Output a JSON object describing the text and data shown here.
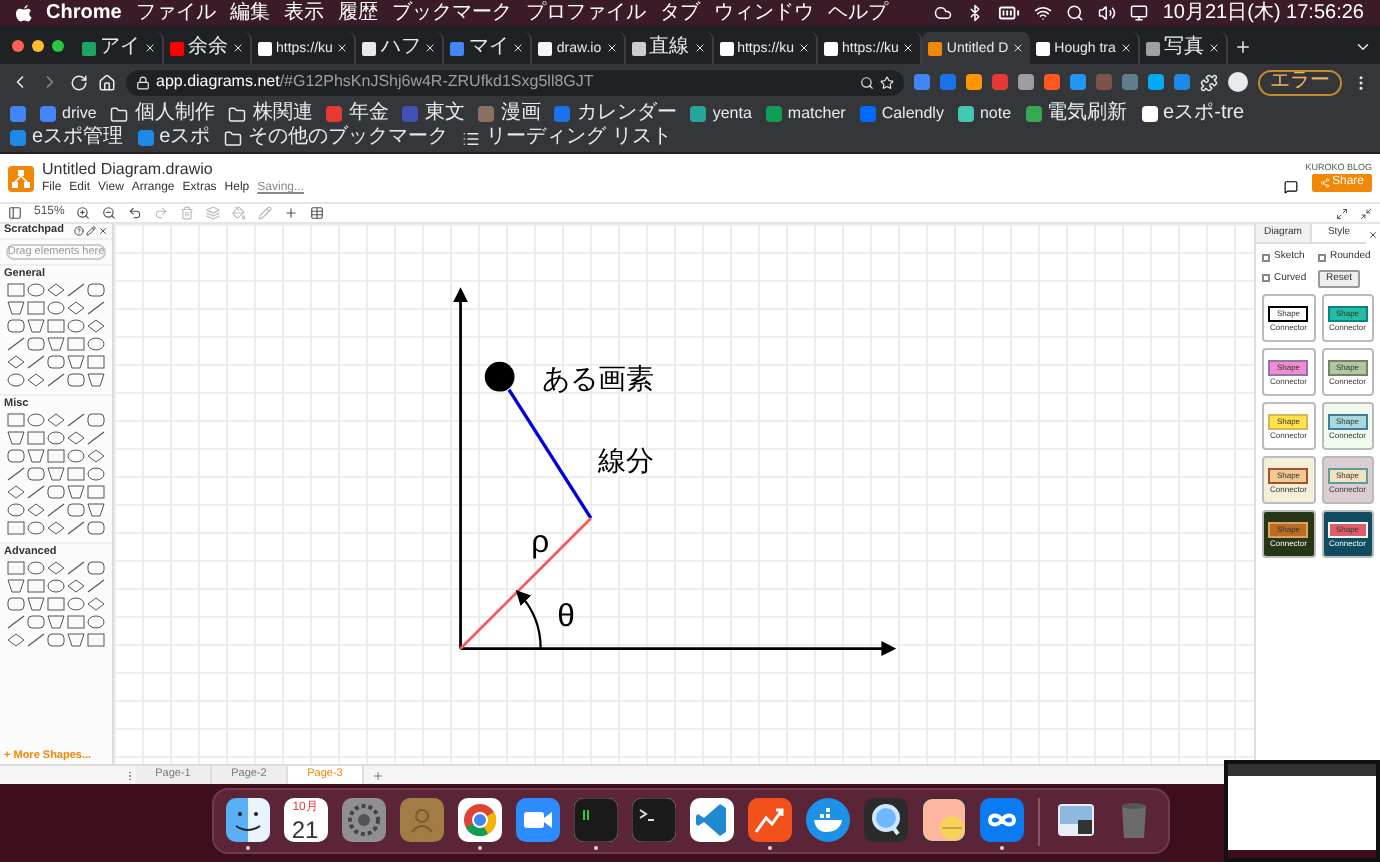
{
  "menubar": {
    "app": "Chrome",
    "items": [
      "ファイル",
      "編集",
      "表示",
      "履歴",
      "ブックマーク",
      "プロファイル",
      "タブ",
      "ウィンドウ",
      "ヘルプ"
    ],
    "clock": "10月21日(木) 17:56:26"
  },
  "tabs": [
    {
      "title": "アイ",
      "selected": false
    },
    {
      "title": "余余",
      "selected": false
    },
    {
      "title": "https://ku",
      "selected": false
    },
    {
      "title": "ハフ",
      "selected": false
    },
    {
      "title": "マイ",
      "selected": false
    },
    {
      "title": "draw.io",
      "selected": false
    },
    {
      "title": "直線",
      "selected": false
    },
    {
      "title": "https://ku",
      "selected": false
    },
    {
      "title": "https://ku",
      "selected": false
    },
    {
      "title": "Untitled D",
      "selected": true
    },
    {
      "title": "Hough tra",
      "selected": false
    },
    {
      "title": "写真",
      "selected": false
    }
  ],
  "address": {
    "host": "app.diagrams.net",
    "path": "/#G12PhsKnJShj6w4R-ZRUfkd1Sxg5ll8GJT"
  },
  "profile_button": "エラー",
  "bookmarks": [
    {
      "label": "drive",
      "kind": "site"
    },
    {
      "label": "個人制作",
      "kind": "folder"
    },
    {
      "label": "株関連",
      "kind": "folder"
    },
    {
      "label": "年金",
      "kind": "site"
    },
    {
      "label": "東文",
      "kind": "site"
    },
    {
      "label": "漫画",
      "kind": "site"
    },
    {
      "label": "カレンダー",
      "kind": "site"
    },
    {
      "label": "yenta",
      "kind": "site"
    },
    {
      "label": "matcher",
      "kind": "site"
    },
    {
      "label": "Calendly",
      "kind": "site"
    },
    {
      "label": "note",
      "kind": "site"
    },
    {
      "label": "電気刷新",
      "kind": "site"
    },
    {
      "label": "eスポ-tre",
      "kind": "site"
    },
    {
      "label": "eスポ管理",
      "kind": "site"
    },
    {
      "label": "eスポ",
      "kind": "site"
    },
    {
      "label": "その他のブックマーク",
      "kind": "folder"
    },
    {
      "label": "リーディング リスト",
      "kind": "list"
    }
  ],
  "drawio": {
    "title": "Untitled Diagram.drawio",
    "menus": [
      "File",
      "Edit",
      "View",
      "Arrange",
      "Extras",
      "Help"
    ],
    "status": "Saving...",
    "user": "KUROKO BLOG",
    "share": "Share",
    "zoom": "515%",
    "sidebar": {
      "scratchpad": "Scratchpad",
      "drop_hint": "Drag elements here",
      "sections": [
        "General",
        "Misc",
        "Advanced"
      ],
      "more": "+ More Shapes..."
    },
    "format_panel": {
      "tabs": [
        {
          "label": "Diagram",
          "selected": false
        },
        {
          "label": "Style",
          "selected": true
        }
      ],
      "options": [
        {
          "label": "Sketch",
          "checked": false
        },
        {
          "label": "Rounded",
          "checked": false
        },
        {
          "label": "Curved",
          "checked": false
        }
      ],
      "reset": "Reset",
      "styles": [
        {
          "shape": "Shape",
          "connector": "Connector",
          "color": "#ffffff"
        },
        {
          "shape": "Shape",
          "connector": "Connector",
          "color": "#21c0a5"
        },
        {
          "shape": "Shape",
          "connector": "Connector",
          "color": "#f08cd0"
        },
        {
          "shape": "Shape",
          "connector": "Connector",
          "color": "#b2c7a2"
        },
        {
          "shape": "Shape",
          "connector": "Connector",
          "color": "#ffe34a"
        },
        {
          "shape": "Shape",
          "connector": "Connector",
          "color": "#a8dadc"
        },
        {
          "shape": "Shape",
          "connector": "Connector",
          "color": "#f2c894"
        },
        {
          "shape": "Shape",
          "connector": "Connector",
          "color": "#f4e1c1"
        },
        {
          "shape": "Shape",
          "connector": "Connector",
          "color": "#bc6c25"
        },
        {
          "shape": "Shape",
          "connector": "Connector",
          "color": "#e05e6a"
        }
      ]
    },
    "diagram": {
      "point_label": "ある画素",
      "segment_label": "線分",
      "rho": "ρ",
      "theta": "θ"
    },
    "pages": [
      {
        "label": "Page-1",
        "selected": false
      },
      {
        "label": "Page-2",
        "selected": false
      },
      {
        "label": "Page-3",
        "selected": true
      }
    ]
  },
  "dock": [
    {
      "kind": "finder",
      "running": true
    },
    {
      "kind": "calendar",
      "month": "10月",
      "day": "21",
      "running": false
    },
    {
      "kind": "settings",
      "running": false
    },
    {
      "kind": "contacts",
      "running": false
    },
    {
      "kind": "chrome",
      "running": true
    },
    {
      "kind": "zoom",
      "running": false
    },
    {
      "kind": "iterm",
      "running": true
    },
    {
      "kind": "terminal",
      "running": false
    },
    {
      "kind": "vscode",
      "running": false
    },
    {
      "kind": "chart",
      "running": true
    },
    {
      "kind": "docker",
      "running": false
    },
    {
      "kind": "quicktime",
      "running": false
    },
    {
      "kind": "pill",
      "running": false
    },
    {
      "kind": "infinity",
      "running": true
    },
    {
      "kind": "separator"
    },
    {
      "kind": "photos",
      "running": false
    },
    {
      "kind": "trash",
      "running": false
    }
  ]
}
